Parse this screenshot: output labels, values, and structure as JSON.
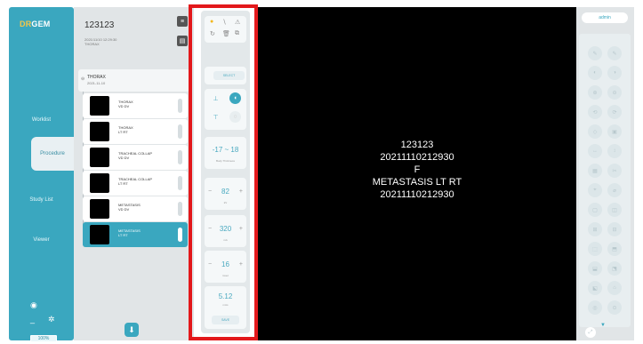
{
  "nav": {
    "logo_dr": "DR",
    "logo_gem": "GEM",
    "items": [
      {
        "label": "Worklist"
      },
      {
        "label": "Procedure"
      },
      {
        "label": "Study List"
      },
      {
        "label": "Viewer"
      }
    ],
    "battery": "100%"
  },
  "patient": {
    "id": "123123",
    "study_line1": "2021/11/10 12:29:30",
    "study_line2": "THORAX"
  },
  "study": {
    "title": "THORAX",
    "date": "2021-11-10"
  },
  "series": [
    {
      "name": "THORAX",
      "view": "VD DV"
    },
    {
      "name": "THORAX",
      "view": "LT RT"
    },
    {
      "name": "TRACHEAL COLLAP",
      "view": "VD DV"
    },
    {
      "name": "TRACHEAL COLLAP",
      "view": "LT RT"
    },
    {
      "name": "METASTASIS",
      "view": "VD DV"
    },
    {
      "name": "METASTASIS",
      "view": "LT RT"
    }
  ],
  "tools": {
    "preset_label": "SELECT",
    "range": "-17 ~ 18",
    "range_caption": "Body Thickness",
    "kvp": "82",
    "kvp_caption": "kV",
    "ma": "320",
    "ma_caption": "mA",
    "ms": "16",
    "ms_caption": "msec",
    "mas": "5.12",
    "mas_caption": "mAs",
    "save_label": "SAVE"
  },
  "viewer": {
    "line1": "123123",
    "line2": "20211110212930",
    "line3": "F",
    "line4": "METASTASIS LT RT",
    "line5": "20211110212930"
  },
  "right_panel": {
    "user": "admin"
  },
  "colors": {
    "accent": "#3aa7bf",
    "highlight": "#e3181b",
    "viewer_bg": "#000000"
  }
}
